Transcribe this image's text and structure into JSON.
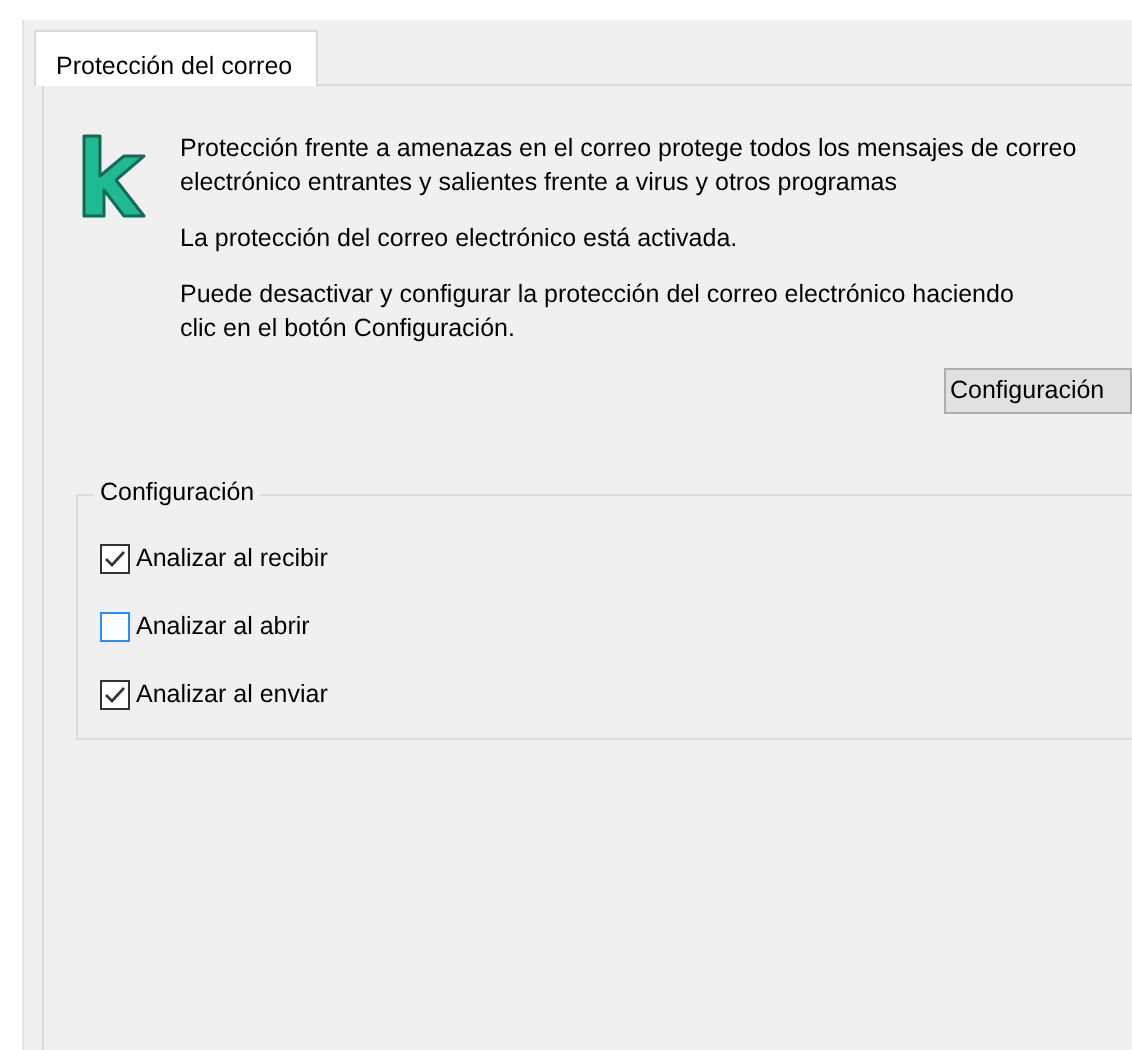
{
  "tabs": [
    {
      "label": "Protección del correo",
      "selected": true
    }
  ],
  "description": "Protección frente a amenazas en el correo protege todos los mensajes de correo electrónico entrantes y salientes frente a virus y otros programas",
  "status": "La protección del correo electrónico está activada.",
  "hint": "Puede desactivar y configurar la protección del correo electrónico haciendo clic en el botón Configuración.",
  "settings_button": "Configuración",
  "group": {
    "title": "Configuración",
    "options": [
      {
        "label": "Analizar al recibir",
        "checked": true
      },
      {
        "label": "Analizar al abrir",
        "checked": false
      },
      {
        "label": "Analizar al enviar",
        "checked": true
      }
    ]
  }
}
